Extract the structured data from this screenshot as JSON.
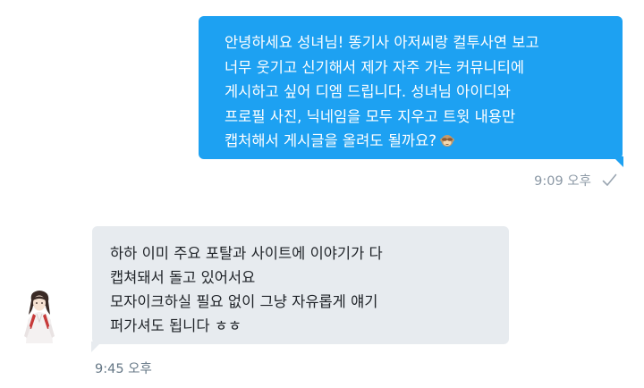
{
  "conversation": {
    "outgoing": {
      "lines": [
        "안녕하세요 성녀님! 똥기사 아저씨랑 컬투사연 보고",
        "너무 웃기고 신기해서 제가 자주 가는 커뮤니티에",
        "게시하고 싶어 디엠 드립니다. 성녀님 아이디와",
        "프로필 사진, 닉네임을 모두 지우고 트윗 내용만",
        "캡처해서 게시글을 올려도 될까요?"
      ],
      "emoji": "see-no-evil-monkey-emoji",
      "timestamp": "9:09 오후",
      "status_icon": "sent-check-icon"
    },
    "incoming": {
      "lines": [
        "하하 이미 주요 포탈과 사이트에 이야기가 다",
        "캡쳐돼서 돌고 있어서요",
        "모자이크하실 필요 없이 그냥 자유롭게 얘기",
        "퍼가셔도 됩니다 ㅎㅎ"
      ],
      "timestamp": "9:45 오후",
      "avatar_icon": "user-avatar-illustration"
    }
  },
  "colors": {
    "outgoing_bubble": "#1da1f2",
    "incoming_bubble": "#e7ebef",
    "meta_text": "#8b98a5"
  }
}
